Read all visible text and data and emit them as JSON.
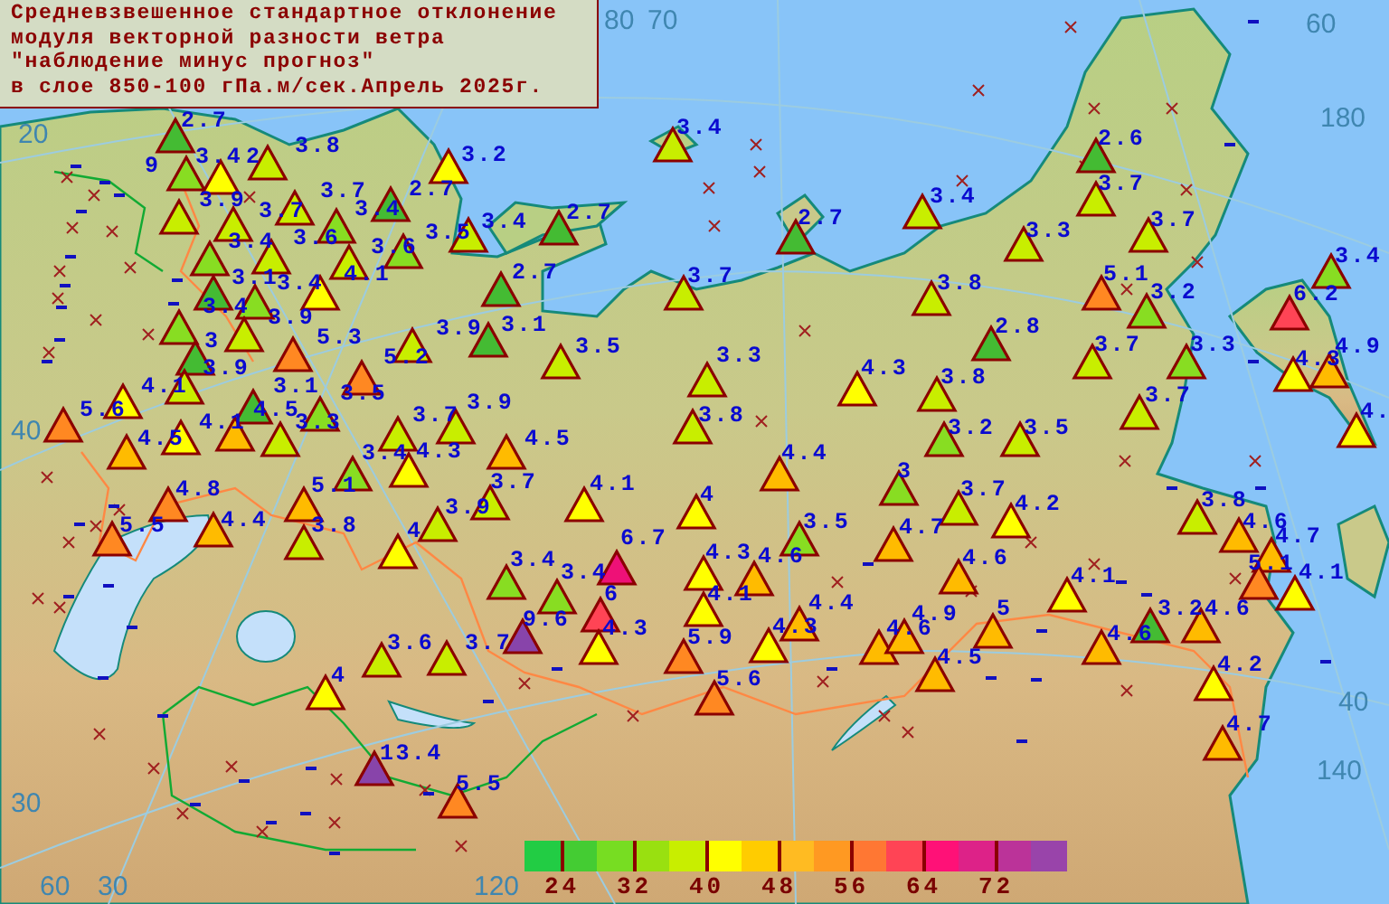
{
  "title": {
    "lines": [
      "Средневзвешенное стандартное отклонение",
      "модуля векторной разности ветра",
      "\"наблюдение минус прогноз\"",
      "в слое 850-100 гПа.м/сек.Апрель 2025г."
    ]
  },
  "grid_labels": [
    "80",
    "70",
    "60",
    "180",
    "20",
    "40",
    "30",
    "60",
    "30",
    "40",
    "140",
    "120"
  ],
  "stations": [
    {
      "value": "2.7",
      "color": "#44bb33",
      "kind": "marker"
    },
    {
      "value": "3.4",
      "color": "#88dd22",
      "kind": "marker"
    },
    {
      "value": "2",
      "color": "#ffff00",
      "kind": "marker"
    },
    {
      "value": "3.8",
      "color": "#c8ee00",
      "kind": "marker"
    },
    {
      "value": "9",
      "kind": "text"
    },
    {
      "value": "3.9",
      "color": "#c8ee00",
      "kind": "marker"
    },
    {
      "value": "3.7",
      "color": "#c8ee00",
      "kind": "marker"
    },
    {
      "value": "3.7",
      "color": "#c8ee00",
      "kind": "marker"
    },
    {
      "value": "3.4",
      "color": "#88dd22",
      "kind": "marker"
    },
    {
      "value": "2.7",
      "color": "#44bb33",
      "kind": "marker"
    },
    {
      "value": "3.2",
      "color": "#ffff00",
      "kind": "marker"
    },
    {
      "value": "3.4",
      "color": "#88dd22",
      "kind": "marker"
    },
    {
      "value": "3.6",
      "color": "#c8ee00",
      "kind": "marker"
    },
    {
      "value": "3.6",
      "color": "#c8ee00",
      "kind": "marker"
    },
    {
      "value": "3.5",
      "color": "#88dd22",
      "kind": "marker"
    },
    {
      "value": "3.1",
      "color": "#44bb33",
      "kind": "marker"
    },
    {
      "value": "3.4",
      "color": "#88dd22",
      "kind": "marker"
    },
    {
      "value": "4.1",
      "color": "#ffff00",
      "kind": "marker"
    },
    {
      "value": "3.4",
      "color": "#88dd22",
      "kind": "marker"
    },
    {
      "value": "3.9",
      "color": "#c8ee00",
      "kind": "marker"
    },
    {
      "value": "3",
      "color": "#44bb33",
      "kind": "marker"
    },
    {
      "value": "5.3",
      "color": "#ff8822",
      "kind": "marker"
    },
    {
      "value": "3.9",
      "color": "#c8ee00",
      "kind": "marker"
    },
    {
      "value": "5.2",
      "color": "#ff8822",
      "kind": "marker"
    },
    {
      "value": "3.9",
      "color": "#c8ee00",
      "kind": "marker"
    },
    {
      "value": "3.1",
      "color": "#44bb33",
      "kind": "marker"
    },
    {
      "value": "3.5",
      "color": "#88dd22",
      "kind": "marker"
    },
    {
      "value": "4.1",
      "color": "#ffff00",
      "kind": "marker"
    },
    {
      "value": "5.6",
      "color": "#ff8822",
      "kind": "marker"
    },
    {
      "value": "4.1",
      "color": "#ffff00",
      "kind": "marker"
    },
    {
      "value": "4.5",
      "color": "#ffbb00",
      "kind": "marker"
    },
    {
      "value": "3.3",
      "color": "#c8ee00",
      "kind": "marker"
    },
    {
      "value": "3.7",
      "color": "#c8ee00",
      "kind": "marker"
    },
    {
      "value": "3.9",
      "color": "#c8ee00",
      "kind": "marker"
    },
    {
      "value": "4.5",
      "color": "#ffbb00",
      "kind": "marker"
    },
    {
      "value": "4.5",
      "color": "#ffbb00",
      "kind": "marker"
    },
    {
      "value": "3.4",
      "color": "#c8ee00",
      "kind": "marker"
    },
    {
      "value": "2.7",
      "color": "#44bb33",
      "kind": "marker"
    },
    {
      "value": "2.7",
      "color": "#44bb33",
      "kind": "marker"
    },
    {
      "value": "3.1",
      "color": "#44bb33",
      "kind": "marker"
    },
    {
      "value": "3.5",
      "color": "#c8ee00",
      "kind": "marker"
    },
    {
      "value": "3.4",
      "color": "#c8ee00",
      "kind": "marker"
    },
    {
      "value": "3.7",
      "color": "#c8ee00",
      "kind": "marker"
    },
    {
      "value": "2.7",
      "color": "#44bb33",
      "kind": "marker"
    },
    {
      "value": "3.3",
      "color": "#c8ee00",
      "kind": "marker"
    },
    {
      "value": "3.8",
      "color": "#c8ee00",
      "kind": "marker"
    },
    {
      "value": "4.3",
      "color": "#ffff00",
      "kind": "marker"
    },
    {
      "value": "2.6",
      "color": "#44bb33",
      "kind": "marker"
    },
    {
      "value": "3.7",
      "color": "#c8ee00",
      "kind": "marker"
    },
    {
      "value": "3.7",
      "color": "#c8ee00",
      "kind": "marker"
    },
    {
      "value": "3.3",
      "color": "#c8ee00",
      "kind": "marker"
    },
    {
      "value": "3.4",
      "color": "#c8ee00",
      "kind": "marker"
    },
    {
      "value": "3.8",
      "color": "#c8ee00",
      "kind": "marker"
    },
    {
      "value": "5.1",
      "color": "#ff8822",
      "kind": "marker"
    },
    {
      "value": "3.2",
      "color": "#88dd22",
      "kind": "marker"
    },
    {
      "value": "2.8",
      "color": "#44bb33",
      "kind": "marker"
    },
    {
      "value": "3.7",
      "color": "#c8ee00",
      "kind": "marker"
    },
    {
      "value": "3.3",
      "color": "#88dd22",
      "kind": "marker"
    },
    {
      "value": "3.8",
      "color": "#c8ee00",
      "kind": "marker"
    },
    {
      "value": "3.7",
      "color": "#c8ee00",
      "kind": "marker"
    },
    {
      "value": "6.2",
      "color": "#ff4455",
      "kind": "marker"
    },
    {
      "value": "3.4",
      "color": "#88dd22",
      "kind": "marker"
    },
    {
      "value": "4.3",
      "color": "#ffff00",
      "kind": "marker"
    },
    {
      "value": "4.9",
      "color": "#ffbb00",
      "kind": "marker"
    },
    {
      "value": "4.",
      "color": "#ffff00",
      "kind": "marker"
    },
    {
      "value": "3.2",
      "color": "#88dd22",
      "kind": "marker"
    },
    {
      "value": "3.5",
      "color": "#c8ee00",
      "kind": "marker"
    },
    {
      "value": "4.8",
      "color": "#ff8822",
      "kind": "marker"
    },
    {
      "value": "5.5",
      "color": "#ff8822",
      "kind": "marker"
    },
    {
      "value": "4.4",
      "color": "#ffbb00",
      "kind": "marker"
    },
    {
      "value": "5.1",
      "color": "#ffbb00",
      "kind": "marker"
    },
    {
      "value": "3.4",
      "color": "#88dd22",
      "kind": "marker"
    },
    {
      "value": "4.3",
      "color": "#ffff00",
      "kind": "marker"
    },
    {
      "value": "3.8",
      "color": "#c8ee00",
      "kind": "marker"
    },
    {
      "value": "3.9",
      "color": "#c8ee00",
      "kind": "marker"
    },
    {
      "value": "4",
      "color": "#ffff00",
      "kind": "marker"
    },
    {
      "value": "3.6",
      "color": "#c8ee00",
      "kind": "marker"
    },
    {
      "value": "4",
      "color": "#ffff00",
      "kind": "marker"
    },
    {
      "value": "13.4",
      "color": "#8844aa",
      "kind": "marker"
    },
    {
      "value": "5.5",
      "color": "#ff8822",
      "kind": "marker"
    },
    {
      "value": "3.7",
      "color": "#c8ee00",
      "kind": "marker"
    },
    {
      "value": "4.1",
      "color": "#ffff00",
      "kind": "marker"
    },
    {
      "value": "4",
      "color": "#ffff00",
      "kind": "marker"
    },
    {
      "value": "4.4",
      "color": "#ffbb00",
      "kind": "marker"
    },
    {
      "value": "3",
      "color": "#88dd22",
      "kind": "marker"
    },
    {
      "value": "3.5",
      "color": "#88dd22",
      "kind": "marker"
    },
    {
      "value": "4.7",
      "color": "#ffbb00",
      "kind": "marker"
    },
    {
      "value": "6.7",
      "color": "#ee1177",
      "kind": "marker"
    },
    {
      "value": "3.4",
      "color": "#88dd22",
      "kind": "marker"
    },
    {
      "value": "3.4",
      "color": "#88dd22",
      "kind": "marker"
    },
    {
      "value": "4.3",
      "color": "#ffff00",
      "kind": "marker"
    },
    {
      "value": "4.6",
      "color": "#ffbb00",
      "kind": "marker"
    },
    {
      "value": "6",
      "color": "#ff4455",
      "kind": "marker"
    },
    {
      "value": "9.6",
      "color": "#8844aa",
      "kind": "marker"
    },
    {
      "value": "4.3",
      "color": "#ffff00",
      "kind": "marker"
    },
    {
      "value": "4.1",
      "color": "#ffff00",
      "kind": "marker"
    },
    {
      "value": "5.9",
      "color": "#ff8822",
      "kind": "marker"
    },
    {
      "value": "4.3",
      "color": "#ffff00",
      "kind": "marker"
    },
    {
      "value": "4.4",
      "color": "#ffbb00",
      "kind": "marker"
    },
    {
      "value": "4.6",
      "color": "#ffbb00",
      "kind": "marker"
    },
    {
      "value": "5.6",
      "color": "#ff8822",
      "kind": "marker"
    },
    {
      "value": "3.7",
      "color": "#c8ee00",
      "kind": "marker"
    },
    {
      "value": "3.7",
      "color": "#c8ee00",
      "kind": "marker"
    },
    {
      "value": "4.2",
      "color": "#ffff00",
      "kind": "marker"
    },
    {
      "value": "4.6",
      "color": "#ffbb00",
      "kind": "marker"
    },
    {
      "value": "4.1",
      "color": "#ffff00",
      "kind": "marker"
    },
    {
      "value": "5",
      "color": "#ffbb00",
      "kind": "marker"
    },
    {
      "value": "4.5",
      "color": "#ffbb00",
      "kind": "marker"
    },
    {
      "value": "4.9",
      "color": "#ffbb00",
      "kind": "marker"
    },
    {
      "value": "4.6",
      "color": "#ffbb00",
      "kind": "marker"
    },
    {
      "value": "3.2",
      "color": "#44bb33",
      "kind": "marker"
    },
    {
      "value": "4.6",
      "color": "#ffbb00",
      "kind": "marker"
    },
    {
      "value": "3.8",
      "color": "#c8ee00",
      "kind": "marker"
    },
    {
      "value": "4.6",
      "color": "#ffbb00",
      "kind": "marker"
    },
    {
      "value": "4.7",
      "color": "#ffbb00",
      "kind": "marker"
    },
    {
      "value": "5.1",
      "color": "#ff8822",
      "kind": "marker"
    },
    {
      "value": "4.1",
      "color": "#ffff00",
      "kind": "marker"
    },
    {
      "value": "4.2",
      "color": "#ffff00",
      "kind": "marker"
    },
    {
      "value": "4.7",
      "color": "#ffbb00",
      "kind": "marker"
    }
  ],
  "legend": {
    "segments": [
      {
        "color": "#22cc44"
      },
      {
        "color": "#44cc33"
      },
      {
        "color": "#77dd22"
      },
      {
        "color": "#99e010"
      },
      {
        "color": "#c8ee00"
      },
      {
        "color": "#ffff00"
      },
      {
        "color": "#ffcc00"
      },
      {
        "color": "#ffbb22"
      },
      {
        "color": "#ff9922"
      },
      {
        "color": "#ff7733"
      },
      {
        "color": "#ff4455"
      },
      {
        "color": "#ff1177"
      },
      {
        "color": "#dd2288"
      },
      {
        "color": "#bb3399"
      },
      {
        "color": "#9944aa"
      }
    ],
    "labels": [
      "24",
      "32",
      "40",
      "48",
      "56",
      "64",
      "72"
    ]
  }
}
